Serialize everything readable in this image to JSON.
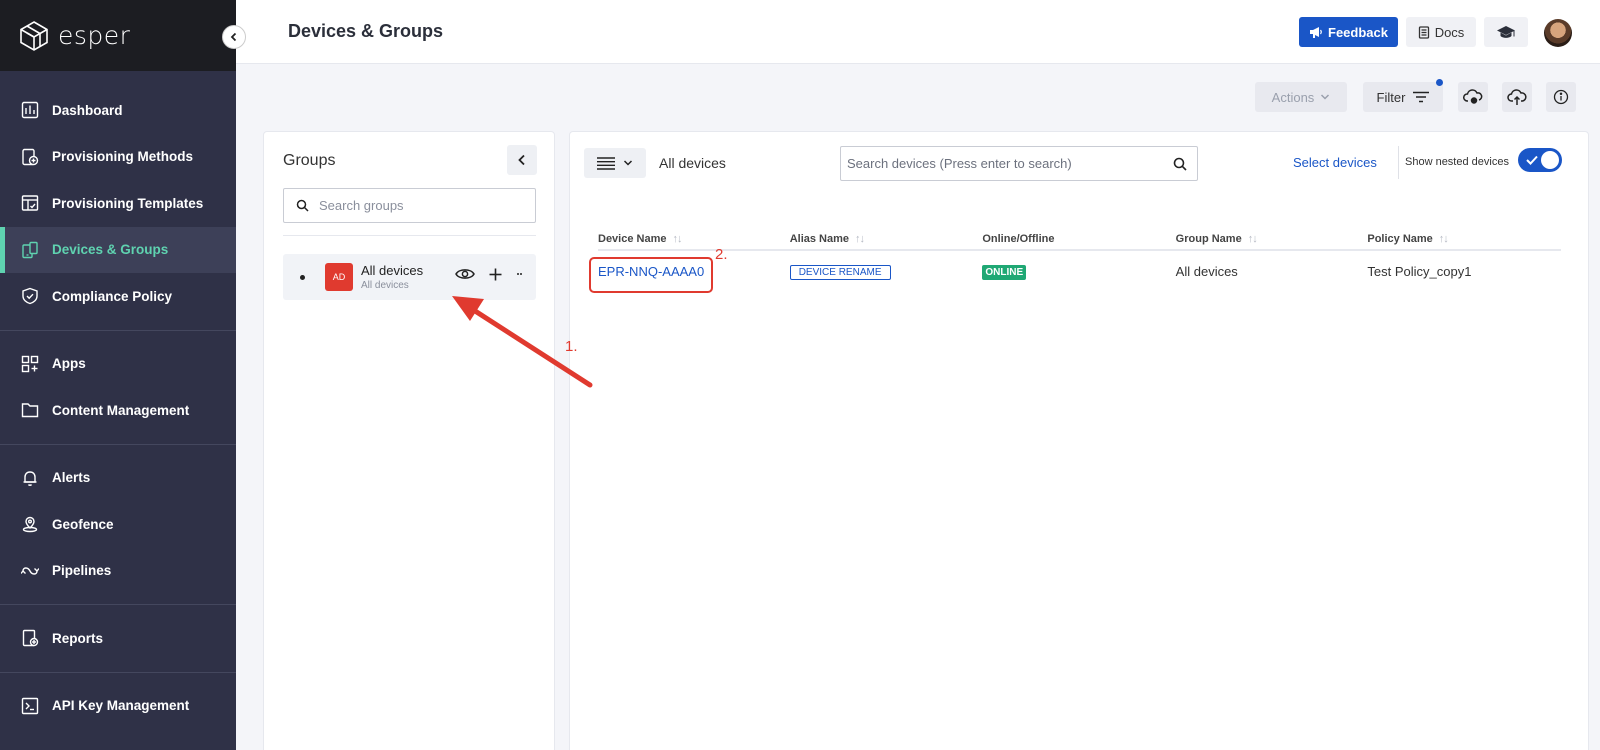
{
  "brand": {
    "name": "esper"
  },
  "sidebar": {
    "items": [
      {
        "label": "Dashboard",
        "icon": "dashboard-icon"
      },
      {
        "label": "Provisioning Methods",
        "icon": "provisioning-icon"
      },
      {
        "label": "Provisioning Templates",
        "icon": "template-icon"
      },
      {
        "label": "Devices & Groups",
        "icon": "devices-icon",
        "active": true
      },
      {
        "label": "Compliance Policy",
        "icon": "shield-icon"
      },
      {
        "label": "Apps",
        "icon": "apps-icon"
      },
      {
        "label": "Content Management",
        "icon": "folder-icon"
      },
      {
        "label": "Alerts",
        "icon": "bell-icon"
      },
      {
        "label": "Geofence",
        "icon": "location-icon"
      },
      {
        "label": "Pipelines",
        "icon": "pipeline-icon"
      },
      {
        "label": "Reports",
        "icon": "report-icon"
      },
      {
        "label": "API Key Management",
        "icon": "terminal-icon"
      }
    ]
  },
  "header": {
    "title": "Devices & Groups",
    "feedback_label": "Feedback",
    "docs_label": "Docs"
  },
  "toolbar": {
    "actions_label": "Actions",
    "filter_label": "Filter"
  },
  "groups": {
    "title": "Groups",
    "search_placeholder": "Search groups",
    "items": [
      {
        "badge": "AD",
        "name": "All devices",
        "sub": "All devices"
      }
    ]
  },
  "devices": {
    "current_group": "All devices",
    "search_placeholder": "Search devices (Press enter to search)",
    "select_label": "Select devices",
    "nested_label": "Show nested devices",
    "nested_enabled": true,
    "columns": [
      "Device Name",
      "Alias Name",
      "Online/Offline",
      "Group Name",
      "Policy Name"
    ],
    "rows": [
      {
        "device": "EPR-NNQ-AAAA0",
        "alias": "DEVICE RENAME",
        "status": "ONLINE",
        "group": "All devices",
        "policy": "Test Policy_copy1"
      }
    ]
  },
  "annotations": {
    "step1": "1.",
    "step2": "2."
  },
  "colors": {
    "accent": "#1a56c7",
    "sidebar": "#2f3147",
    "active": "#5fd3b0",
    "online": "#1fa874",
    "annotation": "#e03a2f"
  }
}
